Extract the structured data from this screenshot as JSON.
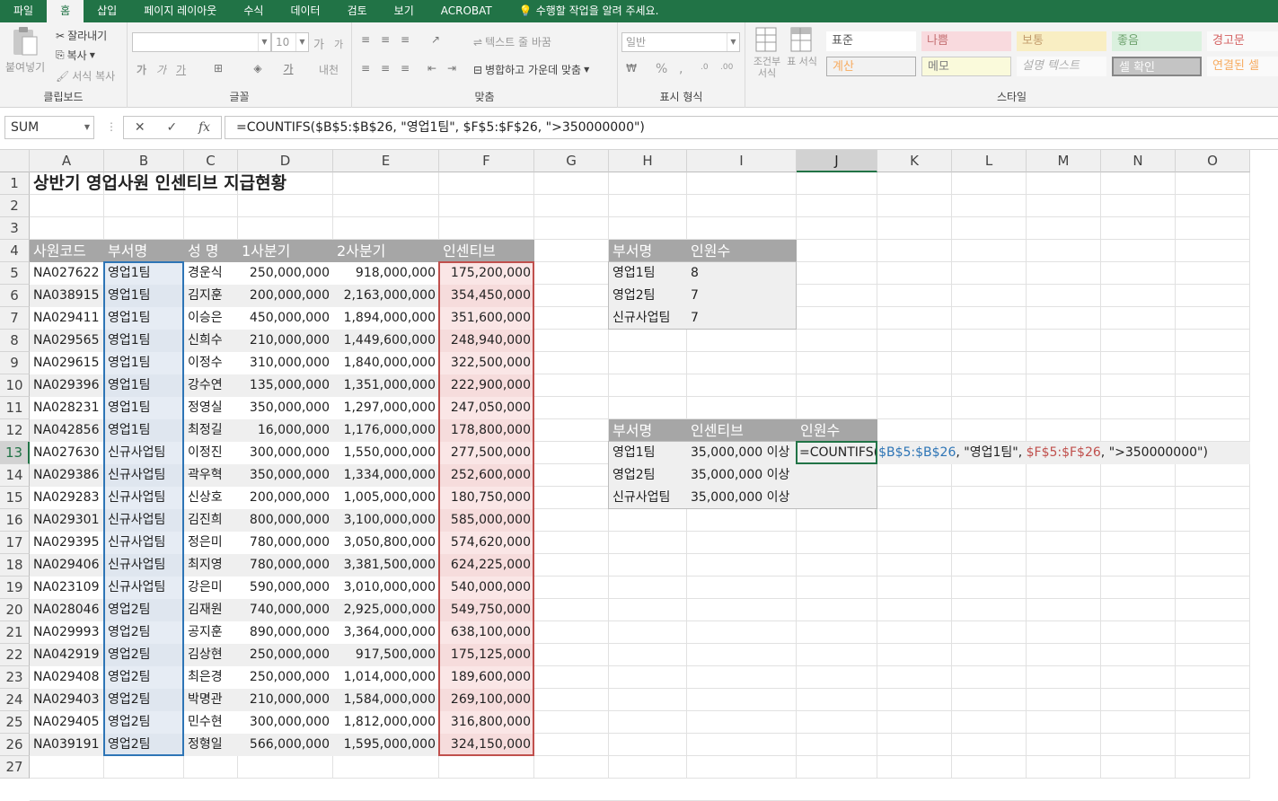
{
  "ribbon_tabs": [
    "파일",
    "홈",
    "삽입",
    "페이지 레이아웃",
    "수식",
    "데이터",
    "검토",
    "보기",
    "ACROBAT"
  ],
  "tell_me": "수행할 작업을 알려 주세요.",
  "clipboard": {
    "paste": "붙여넣기",
    "cut": "잘라내기",
    "copy": "복사",
    "format_painter": "서식 복사",
    "label": "클립보드"
  },
  "font": {
    "size": "10",
    "bold": "가",
    "italic": "가",
    "underline": "가",
    "label": "글꼴",
    "grow": "가",
    "shrink": "가",
    "phonetic": "내천"
  },
  "alignment": {
    "wrap": "텍스트 줄 바꿈",
    "merge": "병합하고 가운데 맞춤",
    "label": "맞춤"
  },
  "number": {
    "format": "일반",
    "percent": "%",
    "comma": ",",
    "dec_up": "←.0 .00",
    "dec_down": ".00 →.0",
    "label": "표시 형식"
  },
  "styles_group": {
    "conditional": "조건부 서식",
    "format_table": "표 서식",
    "label": "스타일",
    "cells": [
      "표준",
      "나쁨",
      "보통",
      "좋음",
      "경고문",
      "계산",
      "메모",
      "설명 텍스트",
      "셀 확인",
      "연결된 셀"
    ]
  },
  "namebox": "SUM",
  "formula": "=COUNTIFS($B$5:$B$26, \"영업1팀\", $F$5:$F$26, \">350000000\")",
  "fx": "fx",
  "columns": [
    "A",
    "B",
    "C",
    "D",
    "E",
    "F",
    "G",
    "H",
    "I",
    "J",
    "K",
    "L",
    "M",
    "N",
    "O"
  ],
  "rows": [
    "1",
    "2",
    "3",
    "4",
    "5",
    "6",
    "7",
    "8",
    "9",
    "10",
    "11",
    "12",
    "13",
    "14",
    "15",
    "16",
    "17",
    "18",
    "19",
    "20",
    "21",
    "22",
    "23",
    "24",
    "25",
    "26",
    "27"
  ],
  "title": "상반기 영업사원 인센티브 지급현황",
  "table_headers": [
    "사원코드",
    "부서명",
    "성  명",
    "1사분기",
    "2사분기",
    "인센티브"
  ],
  "table_rows": [
    [
      "NA027622",
      "영업1팀",
      "경운식",
      "250,000,000",
      "918,000,000",
      "175,200,000"
    ],
    [
      "NA038915",
      "영업1팀",
      "김지훈",
      "200,000,000",
      "2,163,000,000",
      "354,450,000"
    ],
    [
      "NA029411",
      "영업1팀",
      "이승은",
      "450,000,000",
      "1,894,000,000",
      "351,600,000"
    ],
    [
      "NA029565",
      "영업1팀",
      "신희수",
      "210,000,000",
      "1,449,600,000",
      "248,940,000"
    ],
    [
      "NA029615",
      "영업1팀",
      "이정수",
      "310,000,000",
      "1,840,000,000",
      "322,500,000"
    ],
    [
      "NA029396",
      "영업1팀",
      "강수연",
      "135,000,000",
      "1,351,000,000",
      "222,900,000"
    ],
    [
      "NA028231",
      "영업1팀",
      "정영실",
      "350,000,000",
      "1,297,000,000",
      "247,050,000"
    ],
    [
      "NA042856",
      "영업1팀",
      "최정길",
      "16,000,000",
      "1,176,000,000",
      "178,800,000"
    ],
    [
      "NA027630",
      "신규사업팀",
      "이정진",
      "300,000,000",
      "1,550,000,000",
      "277,500,000"
    ],
    [
      "NA029386",
      "신규사업팀",
      "곽우혁",
      "350,000,000",
      "1,334,000,000",
      "252,600,000"
    ],
    [
      "NA029283",
      "신규사업팀",
      "신상호",
      "200,000,000",
      "1,005,000,000",
      "180,750,000"
    ],
    [
      "NA029301",
      "신규사업팀",
      "김진희",
      "800,000,000",
      "3,100,000,000",
      "585,000,000"
    ],
    [
      "NA029395",
      "신규사업팀",
      "정은미",
      "780,000,000",
      "3,050,800,000",
      "574,620,000"
    ],
    [
      "NA029406",
      "신규사업팀",
      "최지영",
      "780,000,000",
      "3,381,500,000",
      "624,225,000"
    ],
    [
      "NA023109",
      "신규사업팀",
      "강은미",
      "590,000,000",
      "3,010,000,000",
      "540,000,000"
    ],
    [
      "NA028046",
      "영업2팀",
      "김재원",
      "740,000,000",
      "2,925,000,000",
      "549,750,000"
    ],
    [
      "NA029993",
      "영업2팀",
      "공지훈",
      "890,000,000",
      "3,364,000,000",
      "638,100,000"
    ],
    [
      "NA042919",
      "영업2팀",
      "김상현",
      "250,000,000",
      "917,500,000",
      "175,125,000"
    ],
    [
      "NA029408",
      "영업2팀",
      "최은경",
      "250,000,000",
      "1,014,000,000",
      "189,600,000"
    ],
    [
      "NA029403",
      "영업2팀",
      "박명관",
      "210,000,000",
      "1,584,000,000",
      "269,100,000"
    ],
    [
      "NA029405",
      "영업2팀",
      "민수현",
      "300,000,000",
      "1,812,000,000",
      "316,800,000"
    ],
    [
      "NA039191",
      "영업2팀",
      "정형일",
      "566,000,000",
      "1,595,000,000",
      "324,150,000"
    ]
  ],
  "summary1": {
    "headers": [
      "부서명",
      "인원수"
    ],
    "rows": [
      [
        "영업1팀",
        "8"
      ],
      [
        "영업2팀",
        "7"
      ],
      [
        "신규사업팀",
        "7"
      ]
    ]
  },
  "summary2": {
    "headers": [
      "부서명",
      "인센티브",
      "인원수"
    ],
    "rows": [
      [
        "영업1팀",
        "35,000,000 이상"
      ],
      [
        "영업2팀",
        "35,000,000 이상"
      ],
      [
        "신규사업팀",
        "35,000,000 이상"
      ]
    ]
  },
  "edit_formula": {
    "eq": "=",
    "fn": "COUNTIFS(",
    "range1": "$B$5:$B$26",
    "sep1": ", \"영업1팀\", ",
    "range2": "$F$5:$F$26",
    "tail": ", \">350000000\")"
  },
  "colors": {
    "excel_green": "#217346",
    "header_gray": "#a6a6a6",
    "range_blue": "#2e75b6",
    "range_red": "#c0504d"
  }
}
